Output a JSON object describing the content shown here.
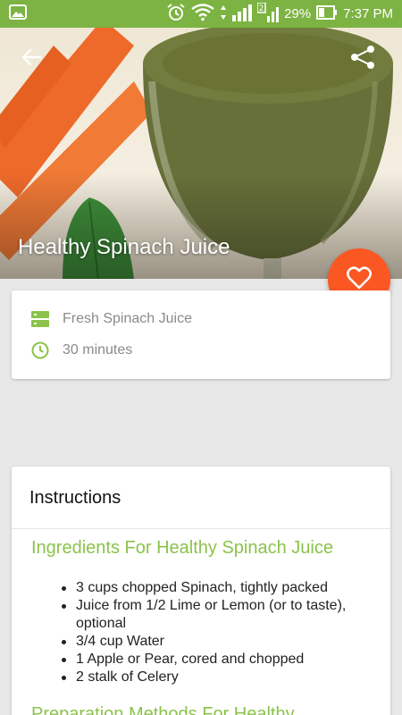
{
  "status_bar": {
    "battery_percent": "29%",
    "time": "7:37 PM",
    "sim_label": "2",
    "icons": [
      "image-icon",
      "alarm-icon",
      "wifi-icon",
      "signal-icon",
      "signal-2-icon",
      "battery-icon"
    ]
  },
  "hero": {
    "title": "Healthy Spinach Juice",
    "back_icon": "arrow-back-icon",
    "share_icon": "share-icon"
  },
  "fab": {
    "icon": "heart-outline-icon",
    "color": "#fb5722"
  },
  "info": {
    "category": "Fresh Spinach Juice",
    "duration": "30 minutes",
    "category_icon": "list-icon",
    "duration_icon": "clock-icon",
    "accent": "#8bc34a"
  },
  "instructions": {
    "title": "Instructions",
    "ingredients_heading": "Ingredients For Healthy Spinach Juice",
    "ingredients": [
      "3 cups chopped Spinach, tightly packed",
      "Juice from 1/2 Lime or Lemon (or to taste), optional",
      "3/4 cup Water",
      "1 Apple or Pear, cored and chopped",
      "2 stalk of Celery"
    ],
    "preparation_heading": "Preparation Methods For Healthy"
  },
  "colors": {
    "status_bar": "#7cb342",
    "accent": "#8bc34a",
    "fab": "#fb5722"
  }
}
